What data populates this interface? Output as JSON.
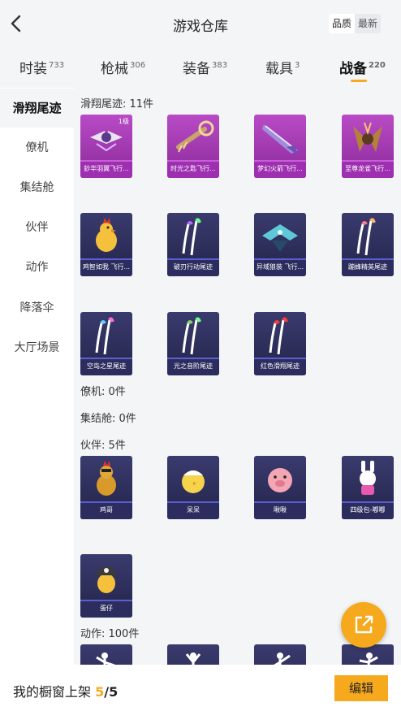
{
  "header": {
    "title": "游戏仓库",
    "sort": [
      "品质",
      "最新"
    ]
  },
  "categories": [
    {
      "label": "时装",
      "count": "733"
    },
    {
      "label": "枪械",
      "count": "306"
    },
    {
      "label": "装备",
      "count": "383"
    },
    {
      "label": "载具",
      "count": "3"
    },
    {
      "label": "战备",
      "count": "220"
    }
  ],
  "sidebar": [
    "滑翔尾迹",
    "僚机",
    "集结舱",
    "伙伴",
    "动作",
    "降落伞",
    "大厅场景"
  ],
  "sections": {
    "glide": {
      "title": "滑翔尾迹: 11件",
      "items": [
        {
          "name": "鈔华羽翼飞行...",
          "level": "1级"
        },
        {
          "name": "时光之匙飞行..."
        },
        {
          "name": "梦幻火箭飞行..."
        },
        {
          "name": "至尊龙雀飞行..."
        },
        {
          "name": "鸡智如我 飞行..."
        },
        {
          "name": "破刃行动尾迹"
        },
        {
          "name": "异域狼装 飞行..."
        },
        {
          "name": "蹦蜂精英尾迹"
        },
        {
          "name": "空岛之星尾迹"
        },
        {
          "name": "光之音阶尾迹"
        },
        {
          "name": "红色滑翔尾迹"
        }
      ]
    },
    "wingman": {
      "title": "僚机: 0件"
    },
    "pod": {
      "title": "集结舱: 0件"
    },
    "partner": {
      "title": "伙伴: 5件",
      "items": [
        {
          "name": "鸡哥"
        },
        {
          "name": "呆呆"
        },
        {
          "name": "啾啾"
        },
        {
          "name": "四级包-嘟嘟"
        },
        {
          "name": "蛋仔"
        }
      ]
    },
    "action": {
      "title": "动作: 100件"
    }
  },
  "footer": {
    "label": "我的橱窗上架",
    "count": "5",
    "sep": "/",
    "total": "5",
    "edit": "编辑"
  }
}
